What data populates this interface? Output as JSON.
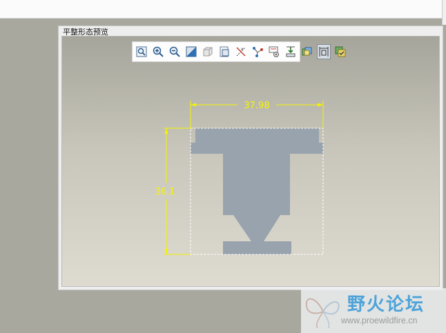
{
  "panel": {
    "title": "平整形态预览"
  },
  "toolbar": {
    "buttons": [
      {
        "icon": "zoom-fit-icon"
      },
      {
        "icon": "zoom-in-icon"
      },
      {
        "icon": "zoom-out-icon"
      },
      {
        "icon": "shading-icon"
      },
      {
        "icon": "view-style-icon"
      },
      {
        "icon": "saved-view-icon"
      },
      {
        "icon": "datum-axes-icon"
      },
      {
        "icon": "datum-points-icon"
      },
      {
        "icon": "display-options-icon"
      },
      {
        "icon": "refit-icon"
      },
      {
        "icon": "layers-icon"
      },
      {
        "icon": "dimensions-icon"
      },
      {
        "icon": "export-view-icon"
      }
    ],
    "active_index": 11
  },
  "drawing": {
    "width_dimension": "37.98",
    "height_dimension": "36.1",
    "dimension_color": "#f4f400",
    "part_color": "#98a3ad"
  },
  "watermark": {
    "cn_text": "野火论坛",
    "url": "www.proewildfire.cn"
  }
}
